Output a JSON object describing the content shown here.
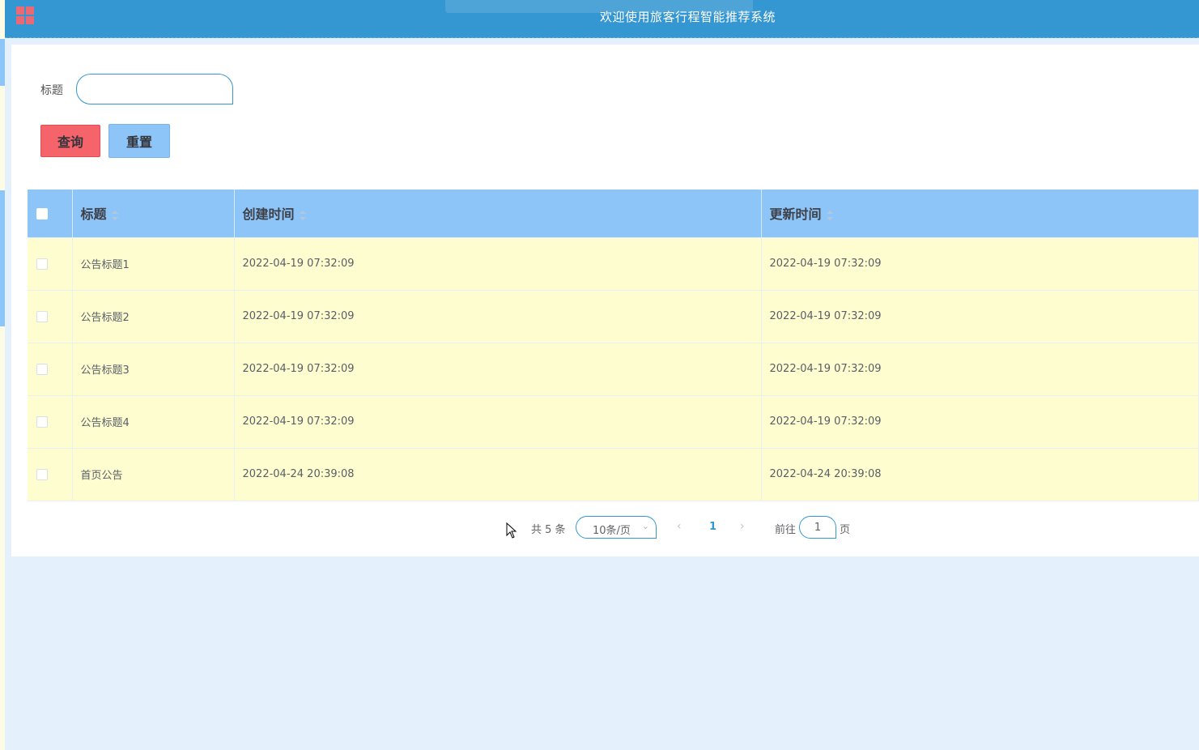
{
  "header": {
    "title": "欢迎使用旅客行程智能推荐系统"
  },
  "search": {
    "label": "标题",
    "value": "",
    "query_label": "查询",
    "reset_label": "重置"
  },
  "table": {
    "columns": [
      "标题",
      "创建时间",
      "更新时间"
    ],
    "rows": [
      {
        "title": "公告标题1",
        "created": "2022-04-19 07:32:09",
        "updated": "2022-04-19 07:32:09"
      },
      {
        "title": "公告标题2",
        "created": "2022-04-19 07:32:09",
        "updated": "2022-04-19 07:32:09"
      },
      {
        "title": "公告标题3",
        "created": "2022-04-19 07:32:09",
        "updated": "2022-04-19 07:32:09"
      },
      {
        "title": "公告标题4",
        "created": "2022-04-19 07:32:09",
        "updated": "2022-04-19 07:32:09"
      },
      {
        "title": "首页公告",
        "created": "2022-04-24 20:39:08",
        "updated": "2022-04-24 20:39:08"
      }
    ]
  },
  "pagination": {
    "total_text": "共 5 条",
    "page_size": "10条/页",
    "current_page": "1",
    "goto_label": "前往",
    "goto_value": "1",
    "page_suffix": "页"
  },
  "colors": {
    "header_bg": "#3597d2",
    "table_head_bg": "#8ec5f8",
    "row_bg": "#fefdd0",
    "query_btn": "#f5636b",
    "reset_btn": "#8ec5f8",
    "logo": "#e96a74"
  }
}
